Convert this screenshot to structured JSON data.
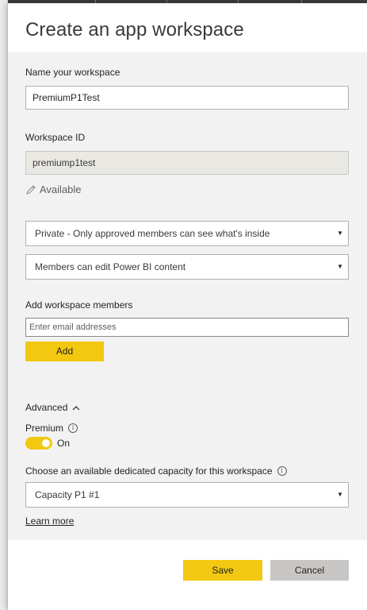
{
  "dialog": {
    "title": "Create an app workspace"
  },
  "name_section": {
    "label": "Name your workspace",
    "value": "PremiumP1Test"
  },
  "workspace_id": {
    "label": "Workspace ID",
    "value": "premiump1test",
    "availability": "Available"
  },
  "privacy_select": {
    "selected": "Private - Only approved members can see what's inside"
  },
  "permission_select": {
    "selected": "Members can edit Power BI content"
  },
  "members": {
    "label": "Add workspace members",
    "placeholder": "Enter email addresses",
    "add_label": "Add"
  },
  "advanced": {
    "label": "Advanced",
    "premium_label": "Premium",
    "toggle_state": "On",
    "capacity_label": "Choose an available dedicated capacity for this workspace",
    "capacity_selected": "Capacity P1 #1",
    "learn_more": "Learn more"
  },
  "footer": {
    "save_label": "Save",
    "cancel_label": "Cancel"
  },
  "colors": {
    "accent": "#f2c811",
    "panel": "#f2f2f2",
    "cancel": "#c8c6c4"
  },
  "icons": {
    "pencil": "pencil-icon",
    "chevron": "chevron-up-icon",
    "info": "info-icon",
    "caret": "caret-down-icon"
  }
}
